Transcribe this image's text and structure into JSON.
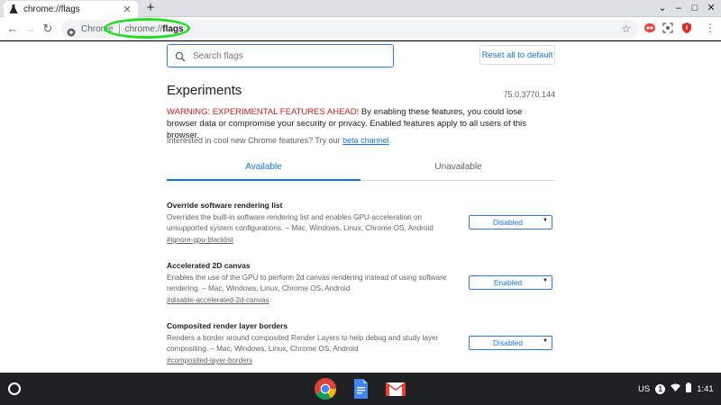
{
  "browser": {
    "tab_title": "chrome://flags",
    "tab_close": "✕",
    "new_tab": "+",
    "window_controls": [
      "⌄",
      "–",
      "□",
      "✕"
    ],
    "address": {
      "chip": "Chrome",
      "scheme": "chrome://",
      "path": "flags"
    },
    "menu_glyph": "⋮"
  },
  "page": {
    "search": {
      "placeholder": "Search flags"
    },
    "reset_label": "Reset all to default",
    "title": "Experiments",
    "version": "75.0.3770.144",
    "warning_red": "WARNING: EXPERIMENTAL FEATURES AHEAD!",
    "warning_text": " By enabling these features, you could lose browser data or compromise your security or privacy. Enabled features apply to all users of this browser.",
    "interest_text": "Interested in cool new Chrome features? Try our ",
    "interest_link": "beta channel",
    "interest_end": ".",
    "tabs": [
      {
        "label": "Available"
      },
      {
        "label": "Unavailable"
      }
    ],
    "flags": [
      {
        "name": "Override software rendering list",
        "description": "Overrides the built-in software rendering list and enables GPU-acceleration on unsupported system configurations. – Mac, Windows, Linux, Chrome OS, Android",
        "id": "#ignore-gpu-blacklist",
        "value": "Disabled"
      },
      {
        "name": "Accelerated 2D canvas",
        "description": "Enables the use of the GPU to perform 2d canvas rendering instead of using software rendering. – Mac, Windows, Linux, Chrome OS, Android",
        "id": "#disable-accelerated-2d-canvas",
        "value": "Enabled"
      },
      {
        "name": "Composited render layer borders",
        "description": "Renders a border around composited Render Layers to help debug and study layer compositing. – Mac, Windows, Linux, Chrome OS, Android",
        "id": "#composited-layer-borders",
        "value": "Disabled"
      }
    ]
  },
  "shelf": {
    "apps": [
      "chrome-icon",
      "docs-icon",
      "gmail-icon"
    ],
    "locale": "US",
    "notification_count": "1",
    "time": "1:41"
  },
  "colors": {
    "accent": "#1a73e8",
    "warning": "#c5221f",
    "annotation": "#22dd22",
    "shelf": "#202124"
  }
}
